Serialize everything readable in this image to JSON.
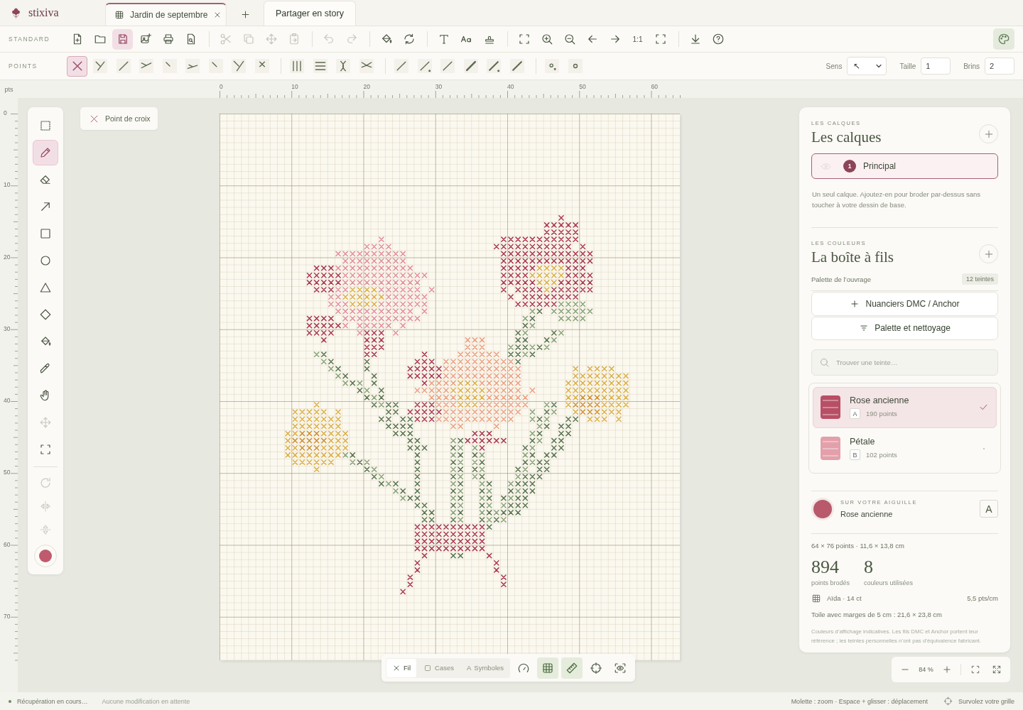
{
  "app": {
    "logo": "stixiva"
  },
  "tabs": [
    {
      "label": "Jardin de septembre",
      "selected": true
    }
  ],
  "share_button": "Partager en story",
  "standard_toolbar": {
    "label": "STANDARD",
    "groups": [
      [
        {
          "selected": false,
          "disabled": false
        },
        {
          "selected": false,
          "disabled": false
        },
        {
          "selected": true,
          "disabled": false
        },
        {
          "selected": false,
          "disabled": false
        },
        {
          "selected": false,
          "disabled": false
        },
        {
          "selected": false,
          "disabled": false
        }
      ],
      [
        {
          "selected": false,
          "disabled": true
        },
        {
          "selected": false,
          "disabled": true
        },
        {
          "selected": false,
          "disabled": true
        },
        {
          "selected": false,
          "disabled": true
        }
      ],
      [
        {
          "selected": false,
          "disabled": true
        },
        {
          "selected": false,
          "disabled": true
        }
      ],
      [
        {
          "selected": false,
          "disabled": false
        },
        {
          "selected": false,
          "disabled": false
        }
      ],
      [
        {
          "selected": false,
          "disabled": false
        },
        {
          "selected": false,
          "disabled": false
        },
        {
          "selected": false,
          "disabled": false
        }
      ],
      [
        {
          "selected": false,
          "disabled": false
        },
        {
          "selected": false,
          "disabled": false
        },
        {
          "selected": false,
          "disabled": false
        },
        {
          "selected": false,
          "disabled": false
        },
        {
          "selected": false,
          "disabled": false
        },
        {
          "selected": false,
          "disabled": false,
          "label": "1:1"
        },
        {
          "selected": false,
          "disabled": false
        }
      ],
      [
        {
          "selected": false,
          "disabled": false
        },
        {
          "selected": false,
          "disabled": false
        }
      ]
    ],
    "palette_button": {
      "selected": true
    }
  },
  "points_toolbar": {
    "label": "POINTS",
    "groups": [
      [
        {
          "selected": true
        },
        {
          "selected": false
        },
        {
          "selected": false
        },
        {
          "selected": false
        },
        {
          "selected": false
        },
        {
          "selected": false
        },
        {
          "selected": false
        },
        {
          "selected": false
        },
        {
          "selected": false
        }
      ],
      [
        {
          "selected": false
        },
        {
          "selected": false
        },
        {
          "selected": false
        },
        {
          "selected": false
        }
      ],
      [
        {
          "selected": false
        },
        {
          "selected": false
        },
        {
          "selected": false
        },
        {
          "selected": false
        },
        {
          "selected": false
        },
        {
          "selected": false
        }
      ],
      [
        {
          "selected": false
        },
        {
          "selected": false
        }
      ]
    ],
    "direction": {
      "label": "Sens",
      "value": "↖"
    },
    "size": {
      "label": "Taille",
      "value": "1"
    },
    "strands": {
      "label": "Brins",
      "value": "2"
    }
  },
  "ruler": {
    "unit": "pts",
    "x_labels": [
      "0",
      "10",
      "20",
      "30",
      "40",
      "50",
      "60"
    ],
    "y_labels": [
      "0",
      "10",
      "20",
      "30",
      "40",
      "50",
      "60",
      "70"
    ]
  },
  "tool_panel": {
    "tools": [
      {
        "selected": false,
        "disabled": false
      },
      {
        "selected": true,
        "disabled": false
      },
      {
        "selected": false,
        "disabled": false
      },
      {
        "selected": false,
        "disabled": false
      },
      {
        "selected": false,
        "disabled": false
      },
      {
        "selected": false,
        "disabled": false
      },
      {
        "selected": false,
        "disabled": false
      },
      {
        "selected": false,
        "disabled": false
      },
      {
        "selected": false,
        "disabled": false
      },
      {
        "selected": false,
        "disabled": false
      },
      {
        "selected": false,
        "disabled": false
      },
      {
        "selected": false,
        "disabled": true
      },
      {
        "selected": false,
        "disabled": false
      }
    ],
    "transforms": [
      {
        "disabled": true
      },
      {
        "disabled": true
      },
      {
        "disabled": true
      }
    ],
    "swatch": {
      "color": "#c05a6e"
    }
  },
  "stitch_chip": "Point de croix",
  "layers": {
    "eyebrow": "LES CALQUES",
    "title": "Les calques",
    "items": [
      {
        "number": "1",
        "name": "Principal",
        "selected": true
      }
    ],
    "hint": "Un seul calque. Ajoutez-en pour broder par-dessus sans toucher à votre dessin de base."
  },
  "colors": {
    "eyebrow": "LES COULEURS",
    "title": "La boîte à fils",
    "palette_label": "Palette de l’ouvrage",
    "count": "12 teintes",
    "buttons": [
      "Nuanciers DMC / Anchor",
      "Palette et nettoyage"
    ],
    "search": {
      "placeholder": "Trouver une teinte…"
    },
    "threads": [
      {
        "name": "Rose ancienne",
        "symbol": "A",
        "count": "190 points",
        "color": "#b84f65",
        "selected": true
      },
      {
        "name": "Pétale",
        "symbol": "B",
        "count": "102 points",
        "color": "#e3a0ab",
        "selected": false
      }
    ]
  },
  "needle": {
    "eyebrow": "SUR VOTRE AIGUILLE",
    "name": "Rose ancienne",
    "symbol": "A",
    "color": "#b85a6c"
  },
  "stats": {
    "dimensions": "64 × 76 points · 11,6 × 13,8 cm",
    "figures": [
      {
        "value": "894",
        "label": "points brodés"
      },
      {
        "value": "8",
        "label": "couleurs utilisées"
      }
    ],
    "fabric": "Aïda · 14 ct",
    "density": "5,5 pts/cm",
    "canvas_size": "Toile avec marges de 5 cm : 21,6 × 23,8 cm",
    "disclaimer": "Couleurs d’affichage indicatives. Les fils DMC et Anchor portent leur référence ; les teintes personnelles n’ont pas d’équivalence fabricant."
  },
  "view_bar": {
    "modes": [
      {
        "label": "Fil",
        "selected": true
      },
      {
        "label": "Cases",
        "selected": false
      },
      {
        "label": "Symboles",
        "selected": false,
        "glyph": "A"
      }
    ],
    "toggles": [
      {
        "on": false
      },
      {
        "on": true
      },
      {
        "on": true
      },
      {
        "on": false
      },
      {
        "on": false
      }
    ]
  },
  "zoom": {
    "value": "84 %"
  },
  "status_bar": {
    "sync": "Récupération en cours…",
    "changes": "Aucune modification en attente",
    "hint": "Molette : zoom · Espace + glisser : déplacement",
    "hover": "Survolez votre grille"
  }
}
